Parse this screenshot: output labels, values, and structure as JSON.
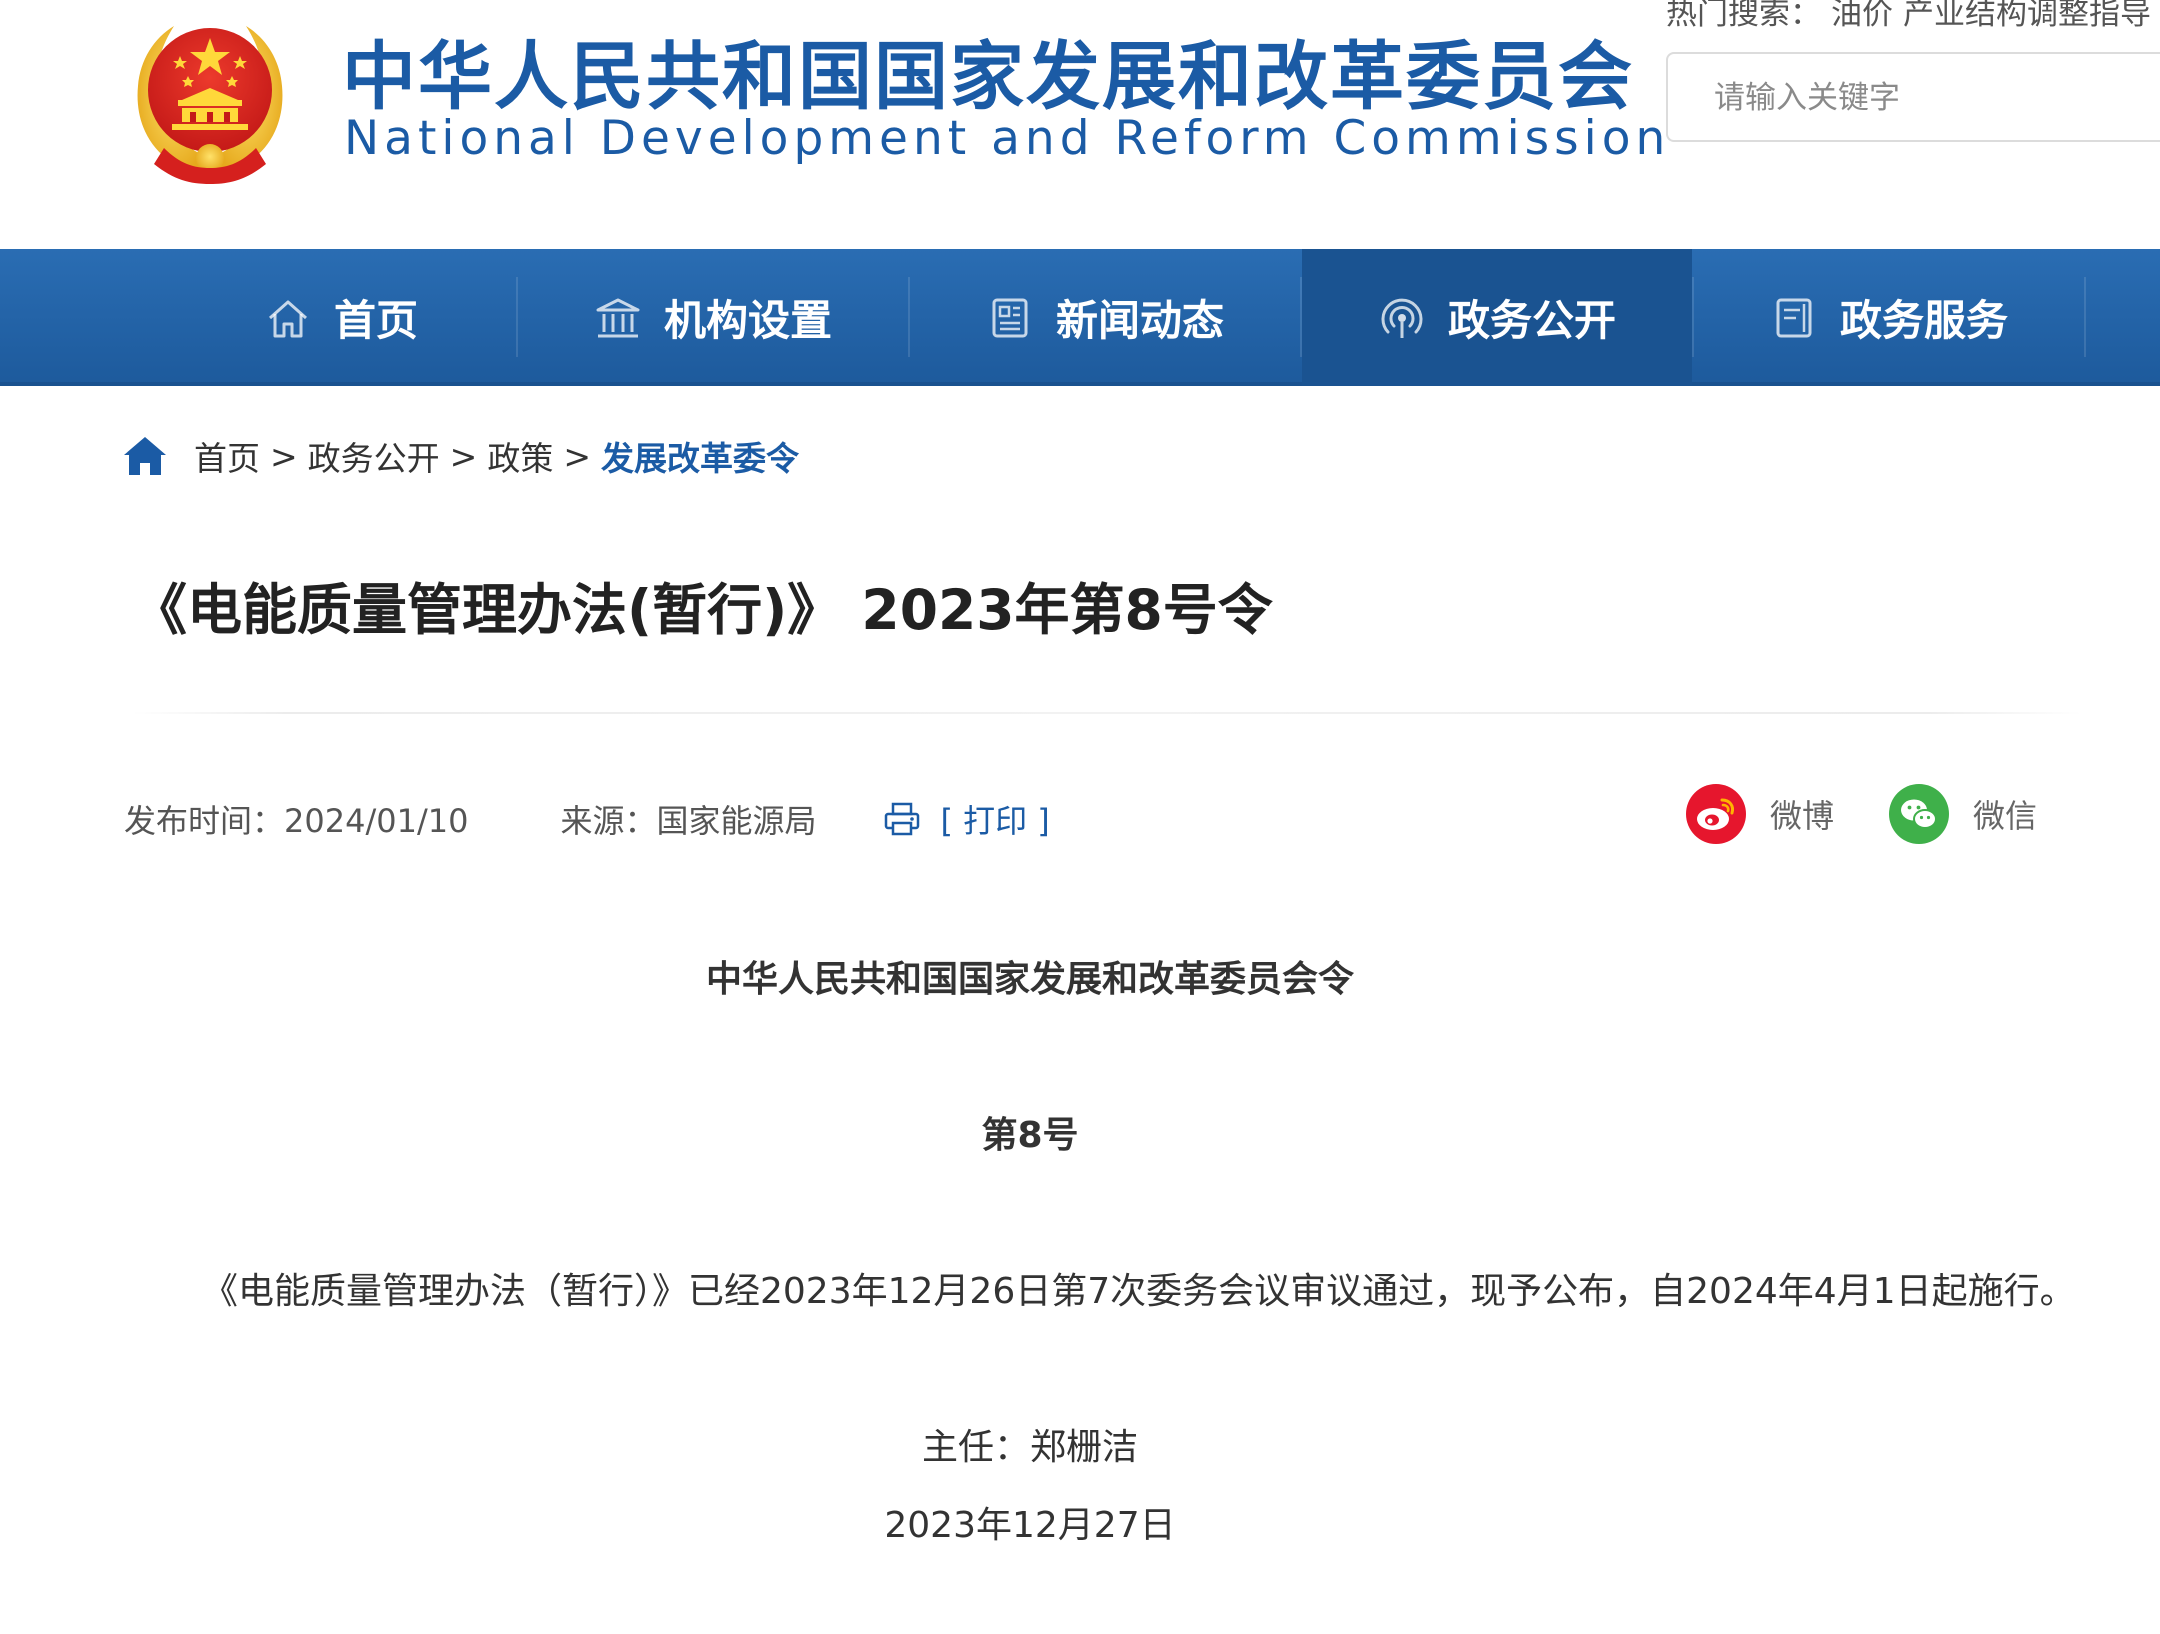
{
  "header": {
    "site_title_cn": "中华人民共和国国家发展和改革委员会",
    "site_title_en": "National Development and Reform Commission",
    "hot_search": {
      "label": "热门搜索：",
      "terms": [
        "油价",
        "产业结构调整指导"
      ]
    },
    "search": {
      "placeholder": "请输入关键字"
    }
  },
  "nav": {
    "items": [
      {
        "label": "首页",
        "icon": "house-icon",
        "active": false
      },
      {
        "label": "机构设置",
        "icon": "institution-building-icon",
        "active": false
      },
      {
        "label": "新闻动态",
        "icon": "newspaper-icon",
        "active": false
      },
      {
        "label": "政务公开",
        "icon": "broadcast-signal-icon",
        "active": true
      },
      {
        "label": "政务服务",
        "icon": "service-document-icon",
        "active": false
      }
    ]
  },
  "breadcrumb": {
    "items": [
      "首页",
      "政务公开",
      "政策"
    ],
    "current": "发展改革委令",
    "separator": ">"
  },
  "article": {
    "title": "《电能质量管理办法(暂行)》 2023年第8号令",
    "meta": {
      "publish_time": "发布时间：2024/01/10",
      "source": "来源：国家能源局",
      "print_label": "[ 打印 ]"
    },
    "share": {
      "weibo_label": "微博",
      "wechat_label": "微信"
    },
    "body": {
      "heading": "中华人民共和国国家发展和改革委员会令",
      "number": "第8号",
      "paragraph": "《电能质量管理办法（暂行）》已经2023年12月26日第7次委务会议审议通过，现予公布，自2024年4月1日起施行。",
      "signer": "主任：郑栅洁",
      "date": "2023年12月27日"
    }
  },
  "colors": {
    "brand_blue": "#1b5ba5",
    "nav_blue": "#1d5a9c",
    "nav_active": "#1a5391",
    "weibo_red": "#e6162d",
    "wechat_green": "#3fb04a",
    "emblem_red": "#d5201e",
    "emblem_gold": "#f3c22e"
  }
}
